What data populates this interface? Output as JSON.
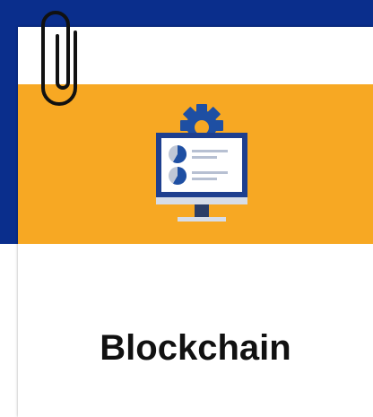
{
  "card": {
    "title": "Blockchain",
    "icon": "monitor-gear-pie-chart-icon",
    "banner_color": "#f7a823"
  },
  "decor": {
    "clip_icon": "paperclip-icon",
    "background_color": "#0a2e8c"
  }
}
